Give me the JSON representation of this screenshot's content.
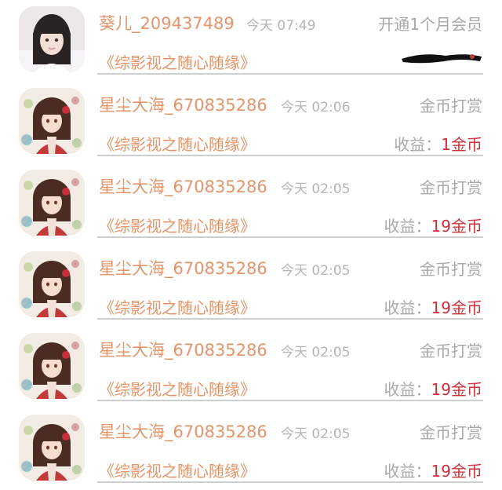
{
  "colors": {
    "name": "#e4956a",
    "muted": "#a9a9a9",
    "amount": "#c9303a",
    "divider": "#cfcfcf"
  },
  "items": [
    {
      "name": "葵儿_209437489",
      "time": "今天 07:49",
      "action": "开通1个月会员",
      "book": "《综影视之随心随缘》",
      "earning_label": "",
      "earning_amount": "",
      "avatar": "girl-photo-avatar"
    },
    {
      "name": "星尘大海_670835286",
      "time": "今天 02:06",
      "action": "金币打赏",
      "book": "《综影视之随心随缘》",
      "earning_label": "收益：",
      "earning_amount": "1金币",
      "avatar": "anime-girl-avatar"
    },
    {
      "name": "星尘大海_670835286",
      "time": "今天 02:05",
      "action": "金币打赏",
      "book": "《综影视之随心随缘》",
      "earning_label": "收益：",
      "earning_amount": "19金币",
      "avatar": "anime-girl-avatar"
    },
    {
      "name": "星尘大海_670835286",
      "time": "今天 02:05",
      "action": "金币打赏",
      "book": "《综影视之随心随缘》",
      "earning_label": "收益：",
      "earning_amount": "19金币",
      "avatar": "anime-girl-avatar"
    },
    {
      "name": "星尘大海_670835286",
      "time": "今天 02:05",
      "action": "金币打赏",
      "book": "《综影视之随心随缘》",
      "earning_label": "收益：",
      "earning_amount": "19金币",
      "avatar": "anime-girl-avatar"
    },
    {
      "name": "星尘大海_670835286",
      "time": "今天 02:05",
      "action": "金币打赏",
      "book": "《综影视之随心随缘》",
      "earning_label": "收益：",
      "earning_amount": "19金币",
      "avatar": "anime-girl-avatar"
    }
  ]
}
